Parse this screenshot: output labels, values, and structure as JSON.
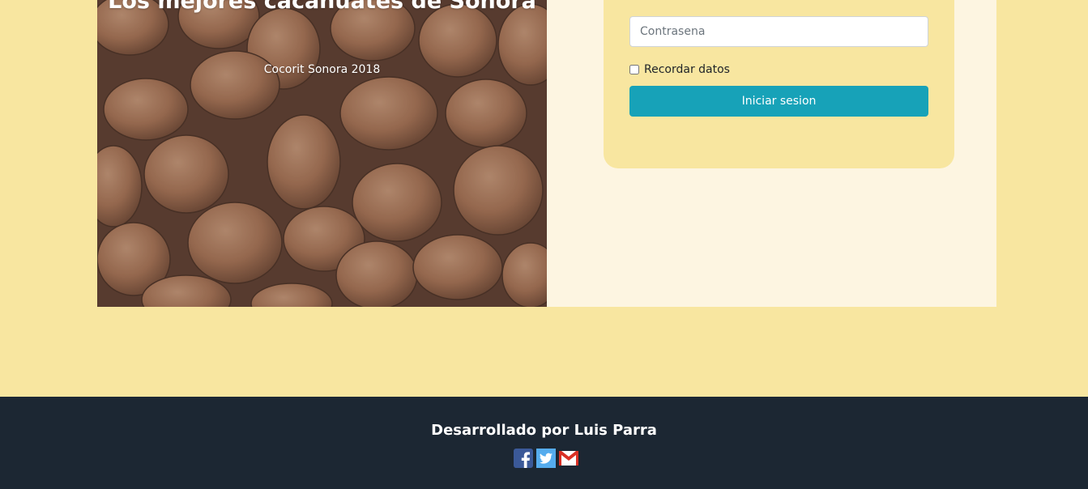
{
  "hero": {
    "title": "Los mejores cacahuates de Sonora",
    "subtitle": "Cocorit Sonora 2018"
  },
  "login": {
    "password_placeholder": "Contrasena",
    "remember_label": "Recordar datos",
    "submit_label": "Iniciar sesion"
  },
  "footer": {
    "credit": "Desarrollado por Luis Parra",
    "social_icons": [
      "facebook-icon",
      "twitter-icon",
      "gmail-icon"
    ]
  },
  "colors": {
    "background": "#f8e6a0",
    "panel": "#fdf5e1",
    "button": "#17a2b8",
    "footer": "#1c2733"
  }
}
